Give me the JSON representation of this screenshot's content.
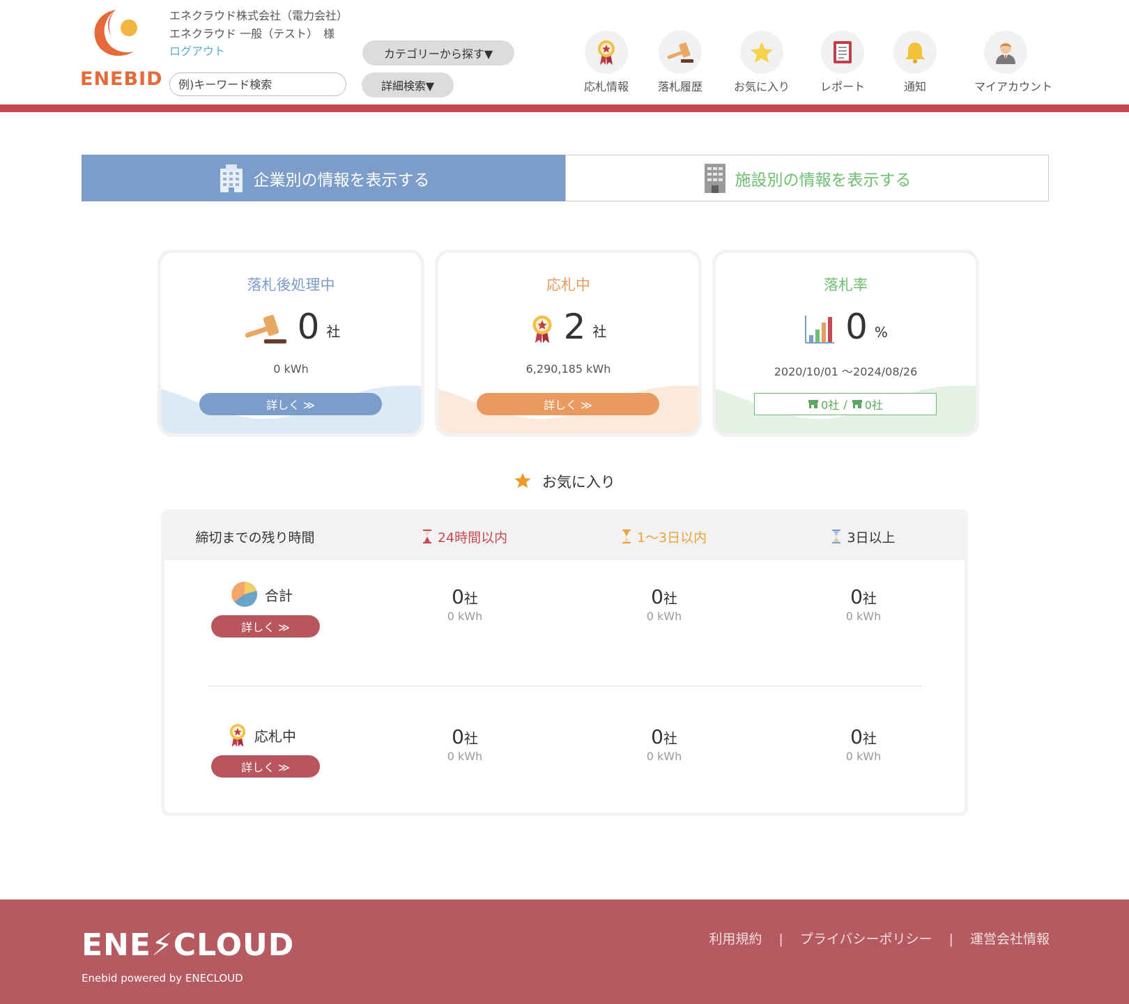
{
  "header": {
    "logo_text": "ENEBID",
    "company_name": "エネクラウド株式会社（電力会社）",
    "user_name": "エネクラウド 一般（テスト）　様",
    "logout": "ログアウト",
    "search_placeholder": "例)キーワード検索",
    "category_button": "カテゴリーから探す▼",
    "detail_search_button": "詳細検索▼",
    "nav": [
      {
        "label": "応札情報",
        "icon": "medal-icon"
      },
      {
        "label": "落札履歴",
        "icon": "gavel-icon"
      },
      {
        "label": "お気に入り",
        "icon": "star-icon"
      },
      {
        "label": "レポート",
        "icon": "report-icon"
      },
      {
        "label": "通知",
        "icon": "bell-icon"
      },
      {
        "label": "マイアカウント",
        "icon": "user-icon"
      }
    ]
  },
  "tabs": {
    "company": "企業別の情報を表示する",
    "facility": "施設別の情報を表示する"
  },
  "cards": [
    {
      "title": "落札後処理中",
      "value": "0",
      "unit": "社",
      "sub": "0 kWh",
      "button": "詳しく ≫",
      "color": "#7c9cc9"
    },
    {
      "title": "応札中",
      "value": "2",
      "unit": "社",
      "sub": "6,290,185 kWh",
      "button": "詳しく ≫",
      "color": "#e99a5e"
    },
    {
      "title": "落札率",
      "value": "0",
      "unit": "%",
      "sub": "2020/10/01 〜2024/08/26",
      "box_a": "0社",
      "box_sep": "/",
      "box_b": "0社",
      "color": "#6fbf72"
    }
  ],
  "favorites": {
    "title": "お気に入り",
    "header": {
      "label": "締切までの残り時間",
      "col1": "24時間以内",
      "col2": "1〜3日以内",
      "col3": "3日以上"
    },
    "rows": [
      {
        "label": "合計",
        "button": "詳しく ≫",
        "cells": [
          {
            "count": "0",
            "unit": "社",
            "kwh": "0 kWh"
          },
          {
            "count": "0",
            "unit": "社",
            "kwh": "0 kWh"
          },
          {
            "count": "0",
            "unit": "社",
            "kwh": "0 kWh"
          }
        ]
      },
      {
        "label": "応札中",
        "button": "詳しく ≫",
        "cells": [
          {
            "count": "0",
            "unit": "社",
            "kwh": "0 kWh"
          },
          {
            "count": "0",
            "unit": "社",
            "kwh": "0 kWh"
          },
          {
            "count": "0",
            "unit": "社",
            "kwh": "0 kWh"
          }
        ]
      }
    ]
  },
  "footer": {
    "logo": "ENE⚡CLOUD",
    "tagline": "Enebid powered by ENECLOUD",
    "links": [
      "利用規約",
      "プライバシーポリシー",
      "運営会社情報"
    ],
    "sep": "|"
  },
  "colors": {
    "brand_red": "#c9484f",
    "footer_bg": "#b55a60",
    "tab_active": "#7c9cc9",
    "tab_inactive_text": "#6fbf72",
    "urgent_red": "#c9484f",
    "warn_orange": "#e9a23b"
  }
}
